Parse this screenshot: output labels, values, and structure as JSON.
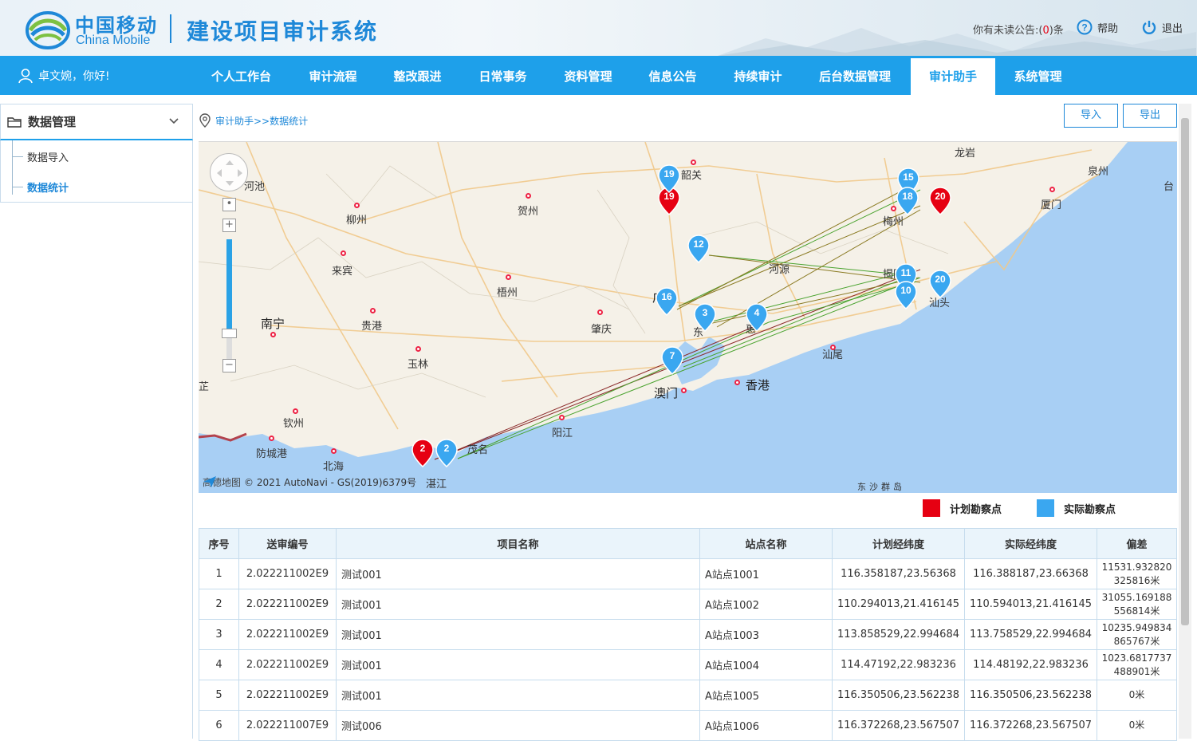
{
  "header": {
    "logo_cn": "中国移动",
    "logo_en": "China Mobile",
    "system_title": "建设项目审计系统",
    "notice_prefix": "你有未读公告:(",
    "notice_count": "0",
    "notice_suffix": ")条",
    "help": "帮助",
    "logout": "退出"
  },
  "nav": {
    "greeting": "卓文婉，你好!",
    "items": [
      "个人工作台",
      "审计流程",
      "整改跟进",
      "日常事务",
      "资料管理",
      "信息公告",
      "持续审计",
      "后台数据管理",
      "审计助手",
      "系统管理"
    ],
    "active": "审计助手"
  },
  "sidebar": {
    "title": "数据管理",
    "items": [
      "数据导入",
      "数据统计"
    ],
    "active": "数据统计"
  },
  "breadcrumb": "审计助手>>数据统计",
  "buttons": {
    "import": "导入",
    "export": "导出"
  },
  "map": {
    "cities": {
      "shaoguan": "韶关",
      "hezhou": "贺州",
      "liuzhou": "柳州",
      "laibin": "来宾",
      "wuzhou": "梧州",
      "hechi": "河池",
      "nanning": "南宁",
      "guigang": "贵港",
      "yulin": "玉林",
      "zhaoqing": "肇庆",
      "guangzhou": "广州",
      "heyuan": "河源",
      "meizhou": "梅州",
      "longyan": "龙岩",
      "quanzhou": "泉州",
      "xiamen": "厦门",
      "jieyang": "揭阳",
      "shantou": "汕头",
      "shanwei": "汕尾",
      "hui": "惠",
      "dong": "东",
      "aomen": "澳门",
      "xianggang": "香港",
      "qinzhou": "钦州",
      "fangchenggang": "防城港",
      "beihai": "北海",
      "yangjiang": "阳江",
      "maoming": "茂名",
      "zhanjiang": "湛江",
      "tai": "台",
      "zhi": "芷"
    },
    "islands": "东沙群岛",
    "copyright": "© 2021 AutoNavi - GS(2019)6379号",
    "amap_label": "高德地图",
    "markers": [
      {
        "label": "19",
        "type": "planned"
      },
      {
        "label": "19",
        "type": "actual"
      },
      {
        "label": "20",
        "type": "planned"
      },
      {
        "label": "15",
        "type": "actual"
      },
      {
        "label": "18",
        "type": "actual"
      },
      {
        "label": "12",
        "type": "actual"
      },
      {
        "label": "16",
        "type": "actual"
      },
      {
        "label": "3",
        "type": "actual"
      },
      {
        "label": "4",
        "type": "actual"
      },
      {
        "label": "7",
        "type": "actual"
      },
      {
        "label": "11",
        "type": "actual"
      },
      {
        "label": "10",
        "type": "actual"
      },
      {
        "label": "20",
        "type": "actual"
      },
      {
        "label": "2",
        "type": "planned"
      },
      {
        "label": "2",
        "type": "actual"
      }
    ]
  },
  "legend": {
    "planned": "计划勘察点",
    "actual": "实际勘察点",
    "planned_color": "#e60012",
    "actual_color": "#3aa7f0"
  },
  "table": {
    "headers": [
      "序号",
      "送审编号",
      "项目名称",
      "站点名称",
      "计划经纬度",
      "实际经纬度",
      "偏差"
    ],
    "rows": [
      [
        "1",
        "2.022211002E9",
        "测试001",
        "A站点1001",
        "116.358187,23.56368",
        "116.388187,23.66368",
        "11531.932820325816米"
      ],
      [
        "2",
        "2.022211002E9",
        "测试001",
        "A站点1002",
        "110.294013,21.416145",
        "110.594013,21.416145",
        "31055.169188556814米"
      ],
      [
        "3",
        "2.022211002E9",
        "测试001",
        "A站点1003",
        "113.858529,22.994684",
        "113.758529,22.994684",
        "10235.949834865767米"
      ],
      [
        "4",
        "2.022211002E9",
        "测试001",
        "A站点1004",
        "114.47192,22.983236",
        "114.48192,22.983236",
        "1023.6817737488901米"
      ],
      [
        "5",
        "2.022211002E9",
        "测试001",
        "A站点1005",
        "116.350506,23.562238",
        "116.350506,23.562238",
        "0米"
      ],
      [
        "6",
        "2.022211007E9",
        "测试006",
        "A站点1006",
        "116.372268,23.567507",
        "116.372268,23.567507",
        "0米"
      ]
    ]
  }
}
